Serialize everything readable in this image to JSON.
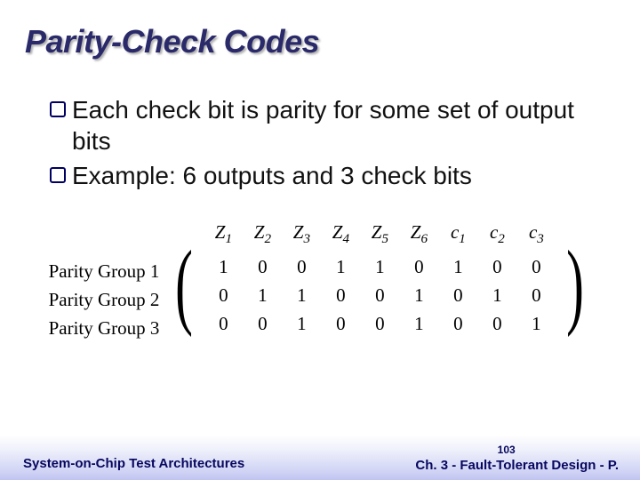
{
  "title": "Parity-Check Codes",
  "bullets": [
    "Each check bit is parity for some set of output bits",
    "Example:  6 outputs and 3 check bits"
  ],
  "matrix": {
    "row_labels": [
      "Parity Group 1",
      "Parity Group 2",
      "Parity Group 3"
    ],
    "col_headers_z": [
      "Z",
      "Z",
      "Z",
      "Z",
      "Z",
      "Z"
    ],
    "col_headers_z_sub": [
      "1",
      "2",
      "3",
      "4",
      "5",
      "6"
    ],
    "col_headers_c": [
      "c",
      "c",
      "c"
    ],
    "col_headers_c_sub": [
      "1",
      "2",
      "3"
    ],
    "rows": [
      [
        "1",
        "0",
        "0",
        "1",
        "1",
        "0",
        "1",
        "0",
        "0"
      ],
      [
        "0",
        "1",
        "1",
        "0",
        "0",
        "1",
        "0",
        "1",
        "0"
      ],
      [
        "0",
        "0",
        "1",
        "0",
        "0",
        "1",
        "0",
        "0",
        "1"
      ]
    ]
  },
  "footer": {
    "left": "System-on-Chip Test Architectures",
    "page": "103",
    "right": "Ch. 3 - Fault-Tolerant Design - P."
  },
  "chart_data": {
    "type": "table",
    "title": "Parity-Check Codes — parity group matrix",
    "row_labels": [
      "Parity Group 1",
      "Parity Group 2",
      "Parity Group 3"
    ],
    "column_labels": [
      "Z1",
      "Z2",
      "Z3",
      "Z4",
      "Z5",
      "Z6",
      "c1",
      "c2",
      "c3"
    ],
    "values": [
      [
        1,
        0,
        0,
        1,
        1,
        0,
        1,
        0,
        0
      ],
      [
        0,
        1,
        1,
        0,
        0,
        1,
        0,
        1,
        0
      ],
      [
        0,
        0,
        1,
        0,
        0,
        1,
        0,
        0,
        1
      ]
    ]
  }
}
